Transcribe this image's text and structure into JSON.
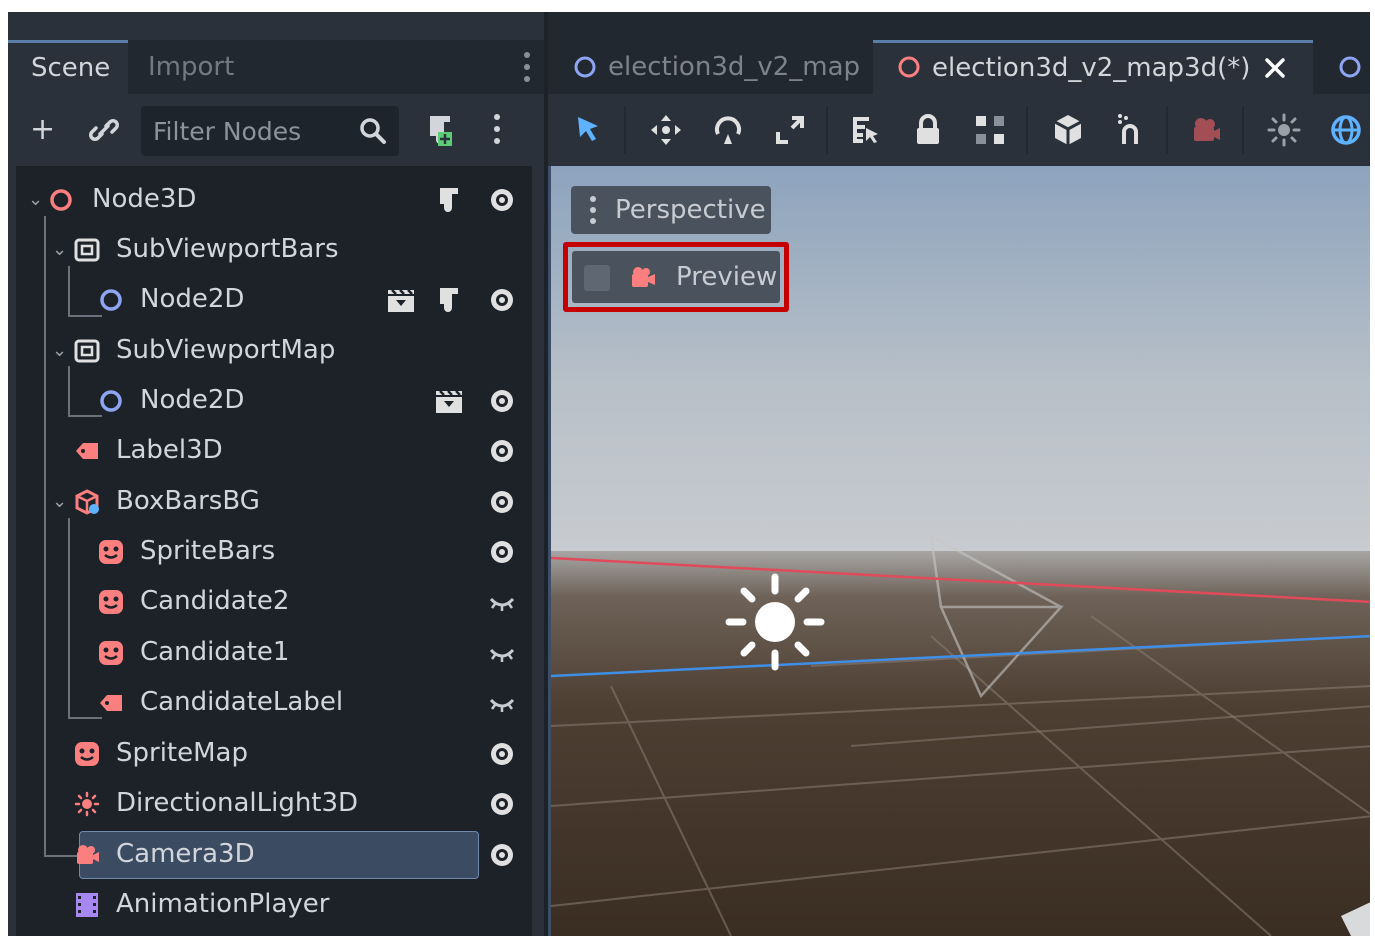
{
  "scene_dock": {
    "tabs": [
      "Scene",
      "Import"
    ],
    "filter_placeholder": "Filter Nodes"
  },
  "tree": {
    "nodes": [
      {
        "label": "Node3D",
        "icon": "node3d-ring-icon",
        "visible": true,
        "script": true
      },
      {
        "label": "SubViewportBars",
        "icon": "subviewport-icon"
      },
      {
        "label": "Node2D",
        "icon": "node2d-ring-icon",
        "visible": true,
        "script": true,
        "clapper": true
      },
      {
        "label": "SubViewportMap",
        "icon": "subviewport-icon"
      },
      {
        "label": "Node2D",
        "icon": "node2d-ring-icon",
        "visible": true,
        "clapper": true
      },
      {
        "label": "Label3D",
        "icon": "label3d-icon",
        "visible": true
      },
      {
        "label": "BoxBarsBG",
        "icon": "csg-box-icon",
        "visible": true
      },
      {
        "label": "SpriteBars",
        "icon": "sprite3d-icon",
        "visible": true
      },
      {
        "label": "Candidate2",
        "icon": "sprite3d-icon",
        "visible": false
      },
      {
        "label": "Candidate1",
        "icon": "sprite3d-icon",
        "visible": false
      },
      {
        "label": "CandidateLabel",
        "icon": "label3d-icon",
        "visible": false
      },
      {
        "label": "SpriteMap",
        "icon": "sprite3d-icon",
        "visible": true
      },
      {
        "label": "DirectionalLight3D",
        "icon": "directional-light-icon",
        "visible": true
      },
      {
        "label": "Camera3D",
        "icon": "camera3d-icon",
        "visible": true,
        "selected": true
      },
      {
        "label": "AnimationPlayer",
        "icon": "animation-player-icon"
      }
    ]
  },
  "editor_tabs": [
    {
      "label": "election3d_v2_map",
      "active": false
    },
    {
      "label": "election3d_v2_map3d(*)",
      "active": true,
      "closable": true
    }
  ],
  "viewport": {
    "perspective_label": "Perspective",
    "preview_label": "Preview",
    "preview_checked": false
  },
  "colors": {
    "accent": "#5a7ea8",
    "node3d": "#fc7f7f",
    "node2d": "#8da5f3",
    "highlight_box": "#c40000",
    "x_axis": "#e04a5a",
    "z_axis": "#3f8ee8"
  }
}
